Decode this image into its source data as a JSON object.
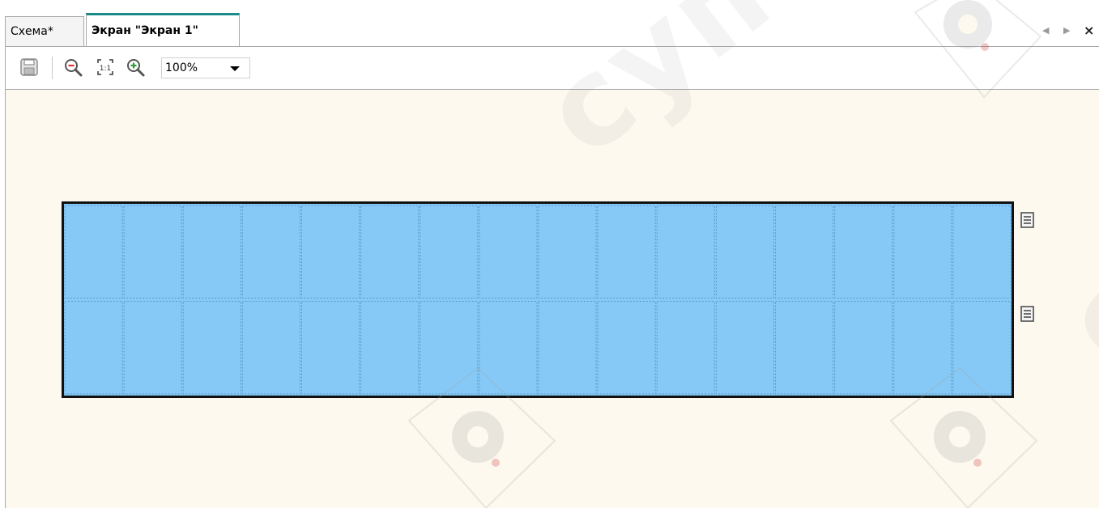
{
  "tabs": [
    {
      "label": "Схема*",
      "active": false
    },
    {
      "label": "Экран \"Экран 1\"",
      "active": true
    }
  ],
  "tab_controls": {
    "prev": "◀",
    "next": "▶",
    "close": "×"
  },
  "toolbar": {
    "zoom_value": "100%",
    "buttons": [
      "save-icon",
      "zoom-out-icon",
      "zoom-actual-size-icon",
      "zoom-in-icon"
    ]
  },
  "display": {
    "rows": 2,
    "columns": 16,
    "fill_color": "#86c9f6",
    "border_color": "#111111"
  },
  "colors": {
    "canvas_background": "#fdf9ef",
    "active_tab_accent": "#1a8a8a"
  },
  "watermark": {
    "text": "суперайс"
  }
}
